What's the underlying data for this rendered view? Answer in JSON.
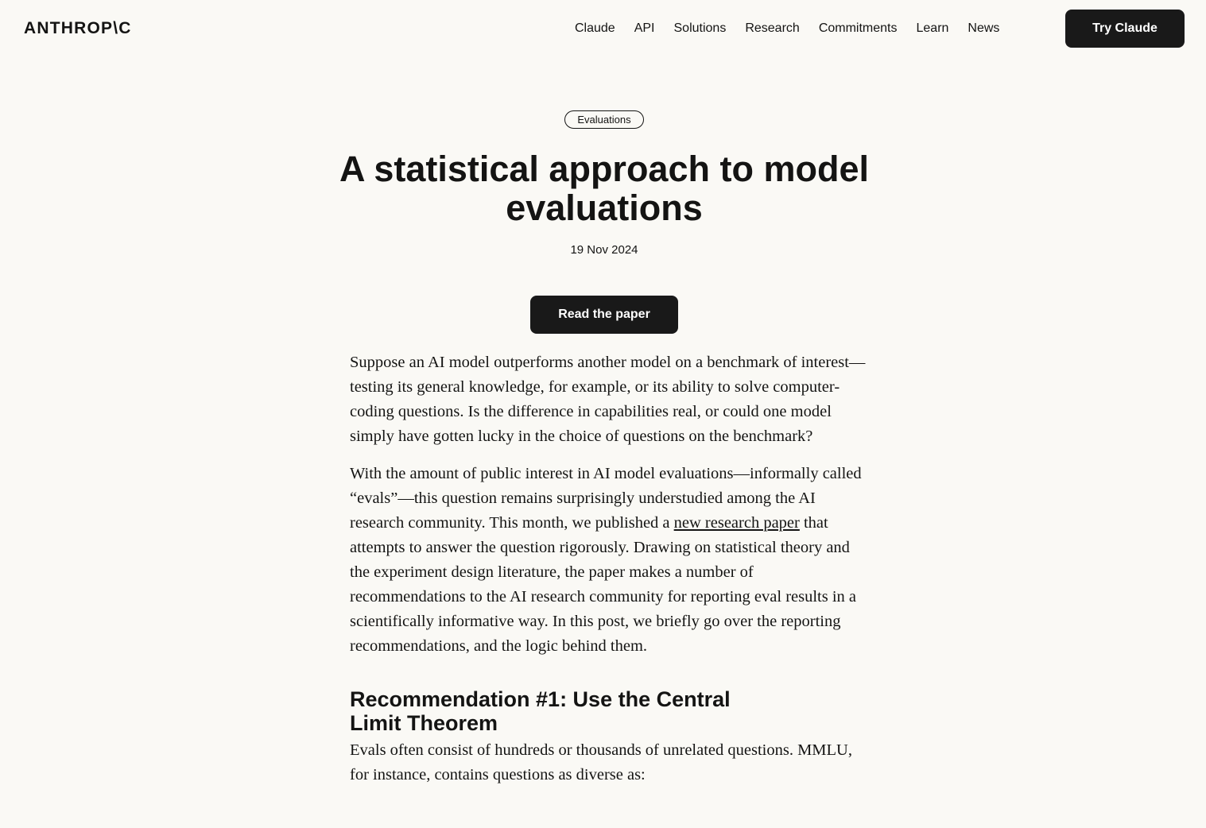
{
  "header": {
    "logo": "ANTHROP\\C",
    "nav": [
      "Claude",
      "API",
      "Solutions",
      "Research",
      "Commitments",
      "Learn",
      "News"
    ],
    "cta": "Try Claude"
  },
  "article": {
    "tag": "Evaluations",
    "title": "A statistical approach to model evaluations",
    "date": "19 Nov 2024",
    "read_paper": "Read the paper",
    "p1": "Suppose an AI model outperforms another model on a benchmark of interest—testing its general knowledge, for example, or its ability to solve computer-coding questions. Is the difference in capabilities real, or could one model simply have gotten lucky in the choice of questions on the benchmark?",
    "p2_before": "With the amount of public interest in AI model evaluations—informally called “evals”—this question remains surprisingly understudied among the AI research community. This month, we published a ",
    "p2_link": "new research paper",
    "p2_after": " that attempts to answer the question rigorously. Drawing on statistical theory and the experiment design literature, the paper makes a number of recommendations to the AI research community for reporting eval results in a scientifically informative way. In this post, we briefly go over the reporting recommendations, and the logic behind them.",
    "h2": "Recommendation #1: Use the Central Limit Theorem",
    "p3": "Evals often consist of hundreds or thousands of unrelated questions. MMLU, for instance, contains questions as diverse as:"
  }
}
